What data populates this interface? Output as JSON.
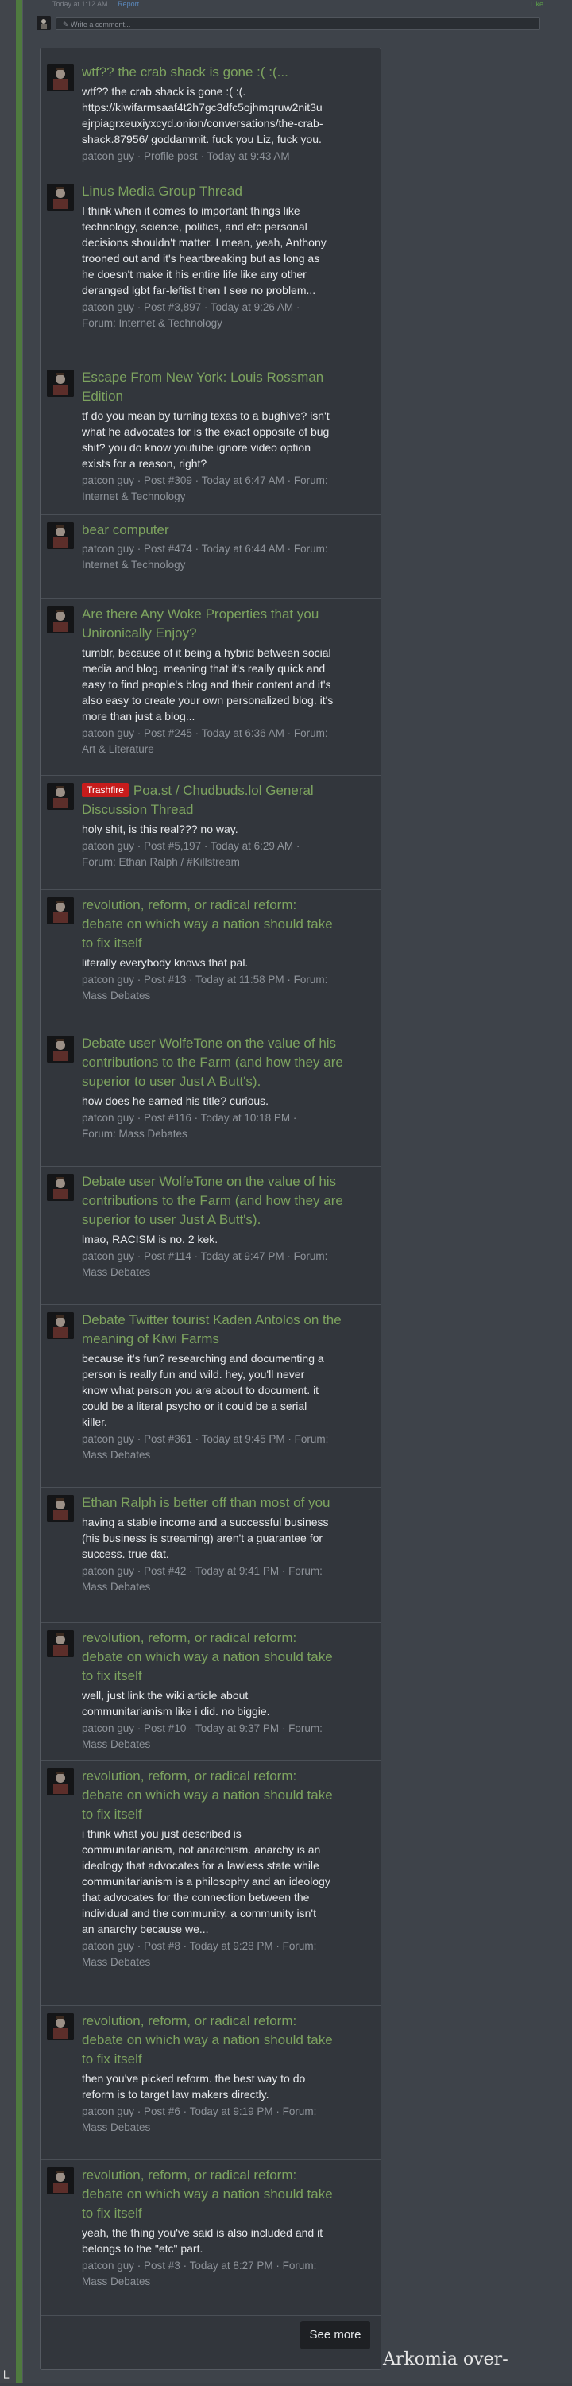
{
  "header": {
    "meta_text": "Today at 1:12 AM",
    "report_label": "Report",
    "like_label": "Like"
  },
  "comment": {
    "placeholder": "Write a comment..."
  },
  "results": [
    {
      "title": "wtf?? the crab shack is gone :( :(...",
      "snippet": "wtf?? the crab shack is gone :( :(.\nhttps://kiwifarmsaaf4t2h7gc3dfc5ojhmqruw2nit3u\nejrpiagrxeuxiyxcyd.onion/conversations/the-crab-\nshack.87956/ goddammit. fuck you Liz, fuck you.",
      "meta": "patcon guy · Profile post · Today at 9:43 AM"
    },
    {
      "title": "Linus Media Group Thread",
      "snippet": "I think when it comes to important things like\ntechnology, science, politics, and etc personal\ndecisions shouldn't matter. I mean, yeah, Anthony\ntrooned out and it's heartbreaking but as long as\nhe doesn't make it his entire life like any other\nderanged lgbt far-leftist then I see no problem...",
      "meta": "patcon guy · Post #3,897 · Today at 9:26 AM ·\nForum: Internet & Technology"
    },
    {
      "title": "Escape From New York: Louis Rossman\nEdition",
      "snippet": "tf do you mean by turning texas to a bughive? isn't\nwhat he advocates for is the exact opposite of bug\nshit? you do know youtube ignore video option\nexists for a reason, right?",
      "meta": "patcon guy · Post #309 · Today at 6:47 AM · Forum:\nInternet & Technology"
    },
    {
      "title": "bear computer",
      "snippet": "",
      "meta": "patcon guy · Post #474 · Today at 6:44 AM · Forum:\nInternet & Technology"
    },
    {
      "title": "Are there Any Woke Properties that you\nUnironically Enjoy?",
      "snippet": "tumblr, because of it being a hybrid between social\nmedia and blog. meaning that it's really quick and\neasy to find people's blog and their content and it's\nalso easy to create your own personalized blog. it's\nmore than just a blog...",
      "meta": "patcon guy · Post #245 · Today at 6:36 AM · Forum:\nArt & Literature"
    },
    {
      "badge": "Trashfire",
      "title": "Poa.st / Chudbuds.lol General\nDiscussion Thread",
      "snippet": "holy shit, is this real??? no way.",
      "meta": "patcon guy · Post #5,197 · Today at 6:29 AM ·\nForum: Ethan Ralph / #Killstream"
    },
    {
      "title": "revolution, reform, or radical reform:\ndebate on which way a nation should take\nto fix itself",
      "snippet": "literally everybody knows that pal.",
      "meta": "patcon guy · Post #13 · Today at 11:58 PM · Forum:\nMass Debates"
    },
    {
      "title": "Debate user WolfeTone on the value of his\ncontributions to the Farm (and how they are\nsuperior to user Just A Butt's).",
      "snippet": "how does he earned his title? curious.",
      "meta": "patcon guy · Post #116 · Today at 10:18 PM ·\nForum: Mass Debates"
    },
    {
      "title": "Debate user WolfeTone on the value of his\ncontributions to the Farm (and how they are\nsuperior to user Just A Butt's).",
      "snippet": "lmao, RACISM is no. 2 kek.",
      "meta": "patcon guy · Post #114 · Today at 9:47 PM · Forum:\nMass Debates"
    },
    {
      "title": "Debate Twitter tourist Kaden Antolos on the\nmeaning of Kiwi Farms",
      "snippet": "because it's fun? researching and documenting a\nperson is really fun and wild. hey, you'll never\nknow what person you are about to document. it\ncould be a literal psycho or it could be a serial\nkiller.",
      "meta": "patcon guy · Post #361 · Today at 9:45 PM · Forum:\nMass Debates"
    },
    {
      "title": "Ethan Ralph is better off than most of you",
      "snippet": "having a stable income and a successful business\n(his business is streaming) aren't a guarantee for\nsuccess. true dat.",
      "meta": "patcon guy · Post #42 · Today at 9:41 PM · Forum:\nMass Debates"
    },
    {
      "title": "revolution, reform, or radical reform:\ndebate on which way a nation should take\nto fix itself",
      "snippet": "well, just link the wiki article about\ncommunitarianism like i did. no biggie.",
      "meta": "patcon guy · Post #10 · Today at 9:37 PM · Forum:\nMass Debates"
    },
    {
      "title": "revolution, reform, or radical reform:\ndebate on which way a nation should take\nto fix itself",
      "snippet": "i think what you just described is\ncommunitarianism, not anarchism. anarchy is an\nideology that advocates for a lawless state while\ncommunitarianism is a philosophy and an ideology\nthat advocates for the connection between the\nindividual and the community. a community isn't\nan anarchy because we...",
      "meta": "patcon guy · Post #8 · Today at 9:28 PM · Forum:\nMass Debates"
    },
    {
      "title": "revolution, reform, or radical reform:\ndebate on which way a nation should take\nto fix itself",
      "snippet": "then you've picked reform. the best way to do\nreform is to target law makers directly.",
      "meta": "patcon guy · Post #6 · Today at 9:19 PM · Forum:\nMass Debates"
    },
    {
      "title": "revolution, reform, or radical reform:\ndebate on which way a nation should take\nto fix itself",
      "snippet": "yeah, the thing you've said is also included and it\nbelongs to the \"etc\" part.",
      "meta": "patcon guy · Post #3 · Today at 8:27 PM · Forum:\nMass Debates"
    }
  ],
  "see_more_label": "See more",
  "footer": {
    "text": "Arkomia over-",
    "symbol": "└"
  }
}
